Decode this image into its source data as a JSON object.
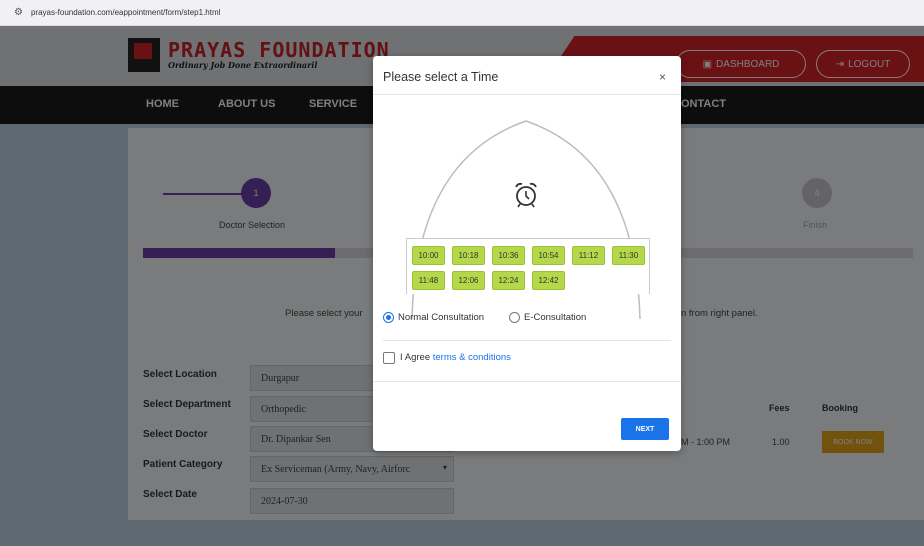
{
  "browser": {
    "url": "prayas-foundation.com/eappointment/form/step1.html"
  },
  "header": {
    "brand_title": "PRAYAS FOUNDATION",
    "brand_tagline": "Ordinary Job Done Extraordinaril",
    "dashboard_label": "DASHBOARD",
    "logout_label": "LOGOUT",
    "brand_color": "#d42229"
  },
  "nav": {
    "items": [
      "HOME",
      "ABOUT US",
      "SERVICE",
      "ONTACT"
    ]
  },
  "steps": {
    "step1_number": "1",
    "step1_label": "Doctor Selection",
    "step4_number": "4",
    "step4_label": "Finish",
    "accent_color": "#6a3fa8"
  },
  "instructions": {
    "left": "Please select your",
    "right": "n from right panel."
  },
  "form": {
    "location_label": "Select Location",
    "location_value": "Durgapur",
    "department_label": "Select Department",
    "department_value": "Orthopedic",
    "doctor_label": "Select Doctor",
    "doctor_value": "Dr. Dipankar Sen",
    "category_label": "Patient Category",
    "category_value": "Ex Serviceman (Army, Navy, Airforc",
    "date_label": "Select Date",
    "date_value": "2024-07-30"
  },
  "table": {
    "fees_header": "Fees",
    "booking_header": "Booking",
    "time_value": "M - 1:00 PM",
    "fees_value": "1.00",
    "book_now_label": "BOOK NOW"
  },
  "modal": {
    "title": "Please select a Time",
    "close_symbol": "×",
    "clock_icon": "alarm-clock-icon",
    "slots": [
      "10:00",
      "10:18",
      "10:36",
      "10:54",
      "11:12",
      "11:30",
      "11:48",
      "12:06",
      "12:24",
      "12:42"
    ],
    "slot_color": "#b4d84a",
    "consult_normal_label": "Normal Consultation",
    "consult_e_label": "E-Consultation",
    "selected_consultation": "Normal Consultation",
    "agree_text": "I Agree ",
    "agree_link": "terms & conditions",
    "next_label": "NEXT"
  }
}
